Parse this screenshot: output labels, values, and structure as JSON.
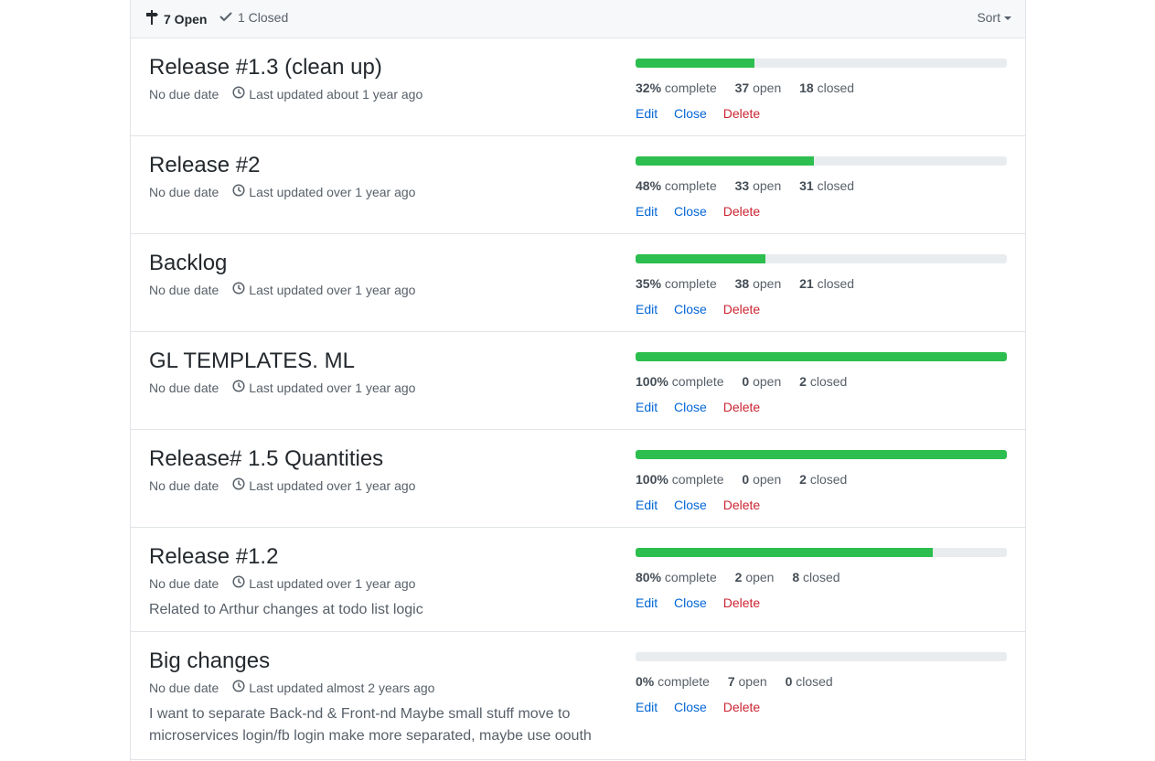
{
  "toolbar": {
    "open_label": "7 Open",
    "closed_label": "1 Closed",
    "sort_label": "Sort"
  },
  "milestones": [
    {
      "title": "Release #1.3 (clean up)",
      "due": "No due date",
      "updated": "Last updated about 1 year ago",
      "description": "",
      "progress": 0.32,
      "percent": "32%",
      "percent_label": "complete",
      "open": "37",
      "open_label": "open",
      "closed": "18",
      "closed_label": "closed",
      "edit": "Edit",
      "close": "Close",
      "delete": "Delete"
    },
    {
      "title": "Release #2",
      "due": "No due date",
      "updated": "Last updated over 1 year ago",
      "description": "",
      "progress": 0.48,
      "percent": "48%",
      "percent_label": "complete",
      "open": "33",
      "open_label": "open",
      "closed": "31",
      "closed_label": "closed",
      "edit": "Edit",
      "close": "Close",
      "delete": "Delete"
    },
    {
      "title": "Backlog",
      "due": "No due date",
      "updated": "Last updated over 1 year ago",
      "description": "",
      "progress": 0.35,
      "percent": "35%",
      "percent_label": "complete",
      "open": "38",
      "open_label": "open",
      "closed": "21",
      "closed_label": "closed",
      "edit": "Edit",
      "close": "Close",
      "delete": "Delete"
    },
    {
      "title": "GL TEMPLATES. ML",
      "due": "No due date",
      "updated": "Last updated over 1 year ago",
      "description": "",
      "progress": 1.0,
      "percent": "100%",
      "percent_label": "complete",
      "open": "0",
      "open_label": "open",
      "closed": "2",
      "closed_label": "closed",
      "edit": "Edit",
      "close": "Close",
      "delete": "Delete"
    },
    {
      "title": "Release# 1.5 Quantities",
      "due": "No due date",
      "updated": "Last updated over 1 year ago",
      "description": "",
      "progress": 1.0,
      "percent": "100%",
      "percent_label": "complete",
      "open": "0",
      "open_label": "open",
      "closed": "2",
      "closed_label": "closed",
      "edit": "Edit",
      "close": "Close",
      "delete": "Delete"
    },
    {
      "title": "Release #1.2",
      "due": "No due date",
      "updated": "Last updated over 1 year ago",
      "description": "Related to Arthur changes at todo list logic",
      "progress": 0.8,
      "percent": "80%",
      "percent_label": "complete",
      "open": "2",
      "open_label": "open",
      "closed": "8",
      "closed_label": "closed",
      "edit": "Edit",
      "close": "Close",
      "delete": "Delete"
    },
    {
      "title": "Big changes",
      "due": "No due date",
      "updated": "Last updated almost 2 years ago",
      "description": "I want to separate Back-nd & Front-nd Maybe small stuff move to microservices login/fb login make more separated, maybe use oouth",
      "progress": 0.0,
      "percent": "0%",
      "percent_label": "complete",
      "open": "7",
      "open_label": "open",
      "closed": "0",
      "closed_label": "closed",
      "edit": "Edit",
      "close": "Close",
      "delete": "Delete"
    }
  ]
}
